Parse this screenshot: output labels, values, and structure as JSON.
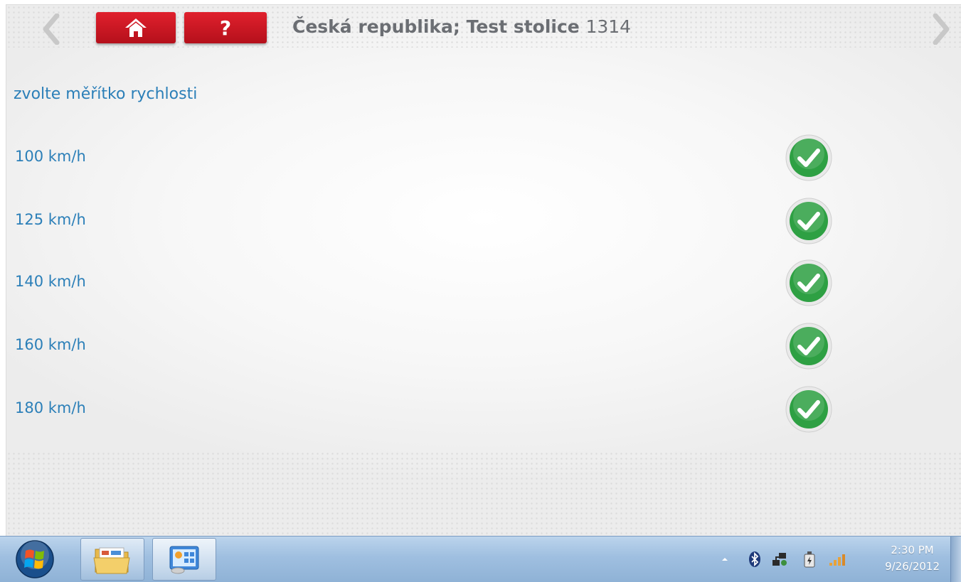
{
  "header": {
    "title_text": "Česká republika; Test stolice",
    "title_number": "1314",
    "help_label": "?",
    "home_icon": "home-icon",
    "back_icon": "chevron-left-icon",
    "forward_icon": "chevron-right-icon"
  },
  "main": {
    "heading": "zvolte měřítko rychlosti",
    "options": [
      {
        "label": "100 km/h",
        "status": "selected",
        "icon": "checkmark-circle-icon"
      },
      {
        "label": "125 km/h",
        "status": "selected",
        "icon": "checkmark-circle-icon"
      },
      {
        "label": "140 km/h",
        "status": "selected",
        "icon": "checkmark-circle-icon"
      },
      {
        "label": "160 km/h",
        "status": "selected",
        "icon": "checkmark-circle-icon"
      },
      {
        "label": "180 km/h",
        "status": "selected",
        "icon": "checkmark-circle-icon"
      }
    ]
  },
  "taskbar": {
    "clock_time": "2:30 PM",
    "clock_date": "9/26/2012",
    "tray_icons": [
      "show-hidden-icons-arrow",
      "bluetooth-icon",
      "network-icon",
      "power-icon",
      "signal-strength-icon"
    ]
  },
  "colors": {
    "accent_red": "#c8131f",
    "label_blue": "#2b7fb8",
    "check_green": "#2ea043"
  }
}
